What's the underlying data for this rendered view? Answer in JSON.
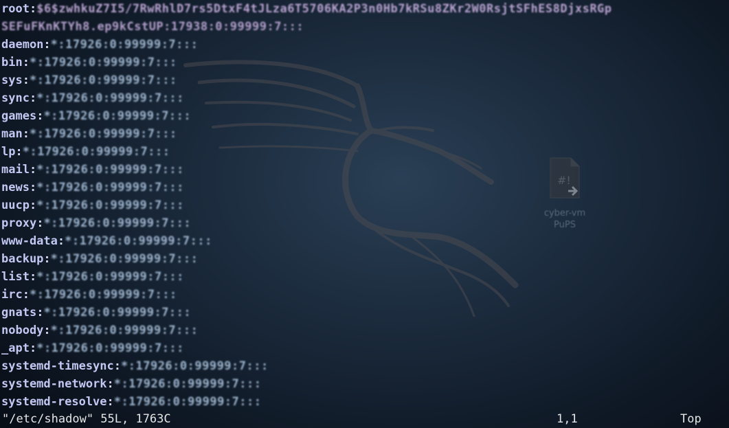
{
  "terminal": {
    "lines": [
      {
        "name": "root",
        "rest": "$6$zwhkuZ7I5/7RwRhlD7rs5DtxF4tJLza6T5706KA2P3n0Hb7kRSu8ZKr2W0RsjtSFhES8DjxsRGp"
      },
      {
        "name": "",
        "rest": "SEFuFKnKTYh8.ep9kCstUP:17938:0:99999:7:::"
      },
      {
        "name": "daemon",
        "rest": "*:17926:0:99999:7:::"
      },
      {
        "name": "bin",
        "rest": "*:17926:0:99999:7:::"
      },
      {
        "name": "sys",
        "rest": "*:17926:0:99999:7:::"
      },
      {
        "name": "sync",
        "rest": "*:17926:0:99999:7:::"
      },
      {
        "name": "games",
        "rest": "*:17926:0:99999:7:::"
      },
      {
        "name": "man",
        "rest": "*:17926:0:99999:7:::"
      },
      {
        "name": "lp",
        "rest": "*:17926:0:99999:7:::"
      },
      {
        "name": "mail",
        "rest": "*:17926:0:99999:7:::"
      },
      {
        "name": "news",
        "rest": "*:17926:0:99999:7:::"
      },
      {
        "name": "uucp",
        "rest": "*:17926:0:99999:7:::"
      },
      {
        "name": "proxy",
        "rest": "*:17926:0:99999:7:::"
      },
      {
        "name": "www-data",
        "rest": "*:17926:0:99999:7:::"
      },
      {
        "name": "backup",
        "rest": "*:17926:0:99999:7:::"
      },
      {
        "name": "list",
        "rest": "*:17926:0:99999:7:::"
      },
      {
        "name": "irc",
        "rest": "*:17926:0:99999:7:::"
      },
      {
        "name": "gnats",
        "rest": "*:17926:0:99999:7:::"
      },
      {
        "name": "nobody",
        "rest": "*:17926:0:99999:7:::"
      },
      {
        "name": "_apt",
        "rest": "*:17926:0:99999:7:::"
      },
      {
        "name": "systemd-timesync",
        "rest": "*:17926:0:99999:7:::"
      },
      {
        "name": "systemd-network",
        "rest": "*:17926:0:99999:7:::"
      },
      {
        "name": "systemd-resolve",
        "rest": "*:17926:0:99999:7:::"
      }
    ]
  },
  "status": {
    "file": "\"/etc/shadow\" 55L, 1763C",
    "position": "1,1",
    "scroll": "Top"
  },
  "desktop_icon": {
    "icon": "file-document-icon",
    "label_line1": "cyber-vm",
    "label_line2": "PuPS"
  },
  "colors": {
    "background": "#1c2c3e",
    "username": "#c2c8f2",
    "field_text": "#5fd0e0",
    "status_text": "#e6e6e6"
  }
}
